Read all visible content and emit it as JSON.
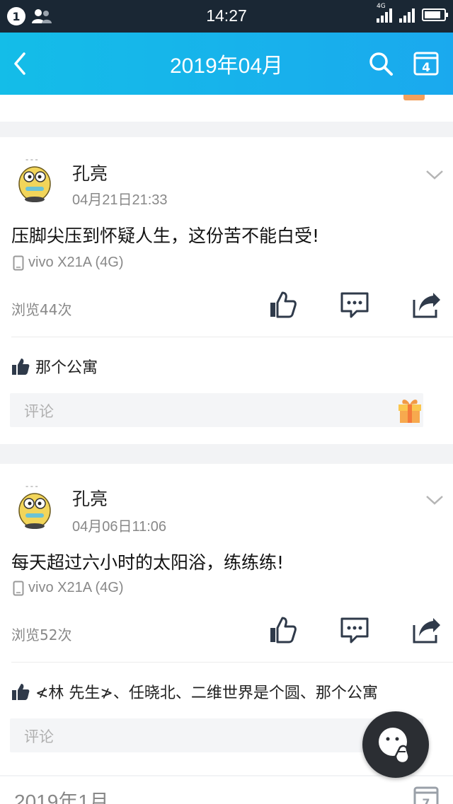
{
  "status_bar": {
    "notification_count": "1",
    "time": "14:27",
    "network_label": "4G"
  },
  "header": {
    "title": "2019年04月",
    "calendar_day": "4"
  },
  "posts": [
    {
      "author": "孔亮",
      "datetime": "04月21日21:33",
      "content": "压脚尖压到怀疑人生，这份苦不能白受!",
      "device": "vivo X21A (4G)",
      "views": "浏览44次",
      "likes": "那个公寓",
      "comment_placeholder": "评论"
    },
    {
      "author": "孔亮",
      "datetime": "04月06日11:06",
      "content": "每天超过六小时的太阳浴，练练练!",
      "device": "vivo X21A (4G)",
      "views": "浏览52次",
      "likes": "≮林 先生≯、任晓北、二维世界是个圆、那个公寓",
      "comment_placeholder": "评论"
    }
  ],
  "next_section": {
    "month_label": "2019年1月",
    "calendar_day": "7"
  },
  "colors": {
    "header_start": "#14bde8",
    "header_end": "#1aa9ee",
    "status_bar": "#1a2734",
    "accent_icon": "#2f3a4a"
  }
}
